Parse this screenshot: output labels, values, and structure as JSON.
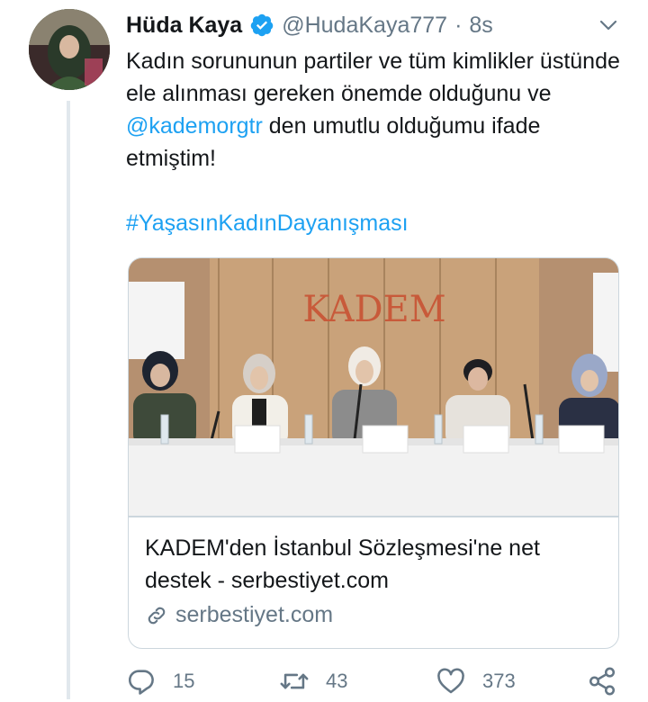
{
  "tweet": {
    "author_name": "Hüda Kaya",
    "handle": "@HudaKaya777",
    "separator": "·",
    "time": "8s",
    "text_before": "Kadın sorununun partiler ve tüm kimlikler üstünde ele alınması gereken önemde olduğunu ve ",
    "mention": "@kademorgtr",
    "text_after": " den umutlu olduğumu ifade etmiştim!",
    "hashtag": "#YaşasınKadınDayanışması"
  },
  "card": {
    "image_sign_text": "KADEM",
    "title": "KADEM'den İstanbul Sözleşmesi'ne net destek - serbestiyet.com",
    "domain": "serbestiyet.com"
  },
  "actions": {
    "replies": "15",
    "retweets": "43",
    "likes": "373"
  },
  "icons": {
    "verified": "verified-badge-icon",
    "more": "chevron-down-icon",
    "link": "link-icon",
    "reply": "reply-icon",
    "retweet": "retweet-icon",
    "like": "heart-icon",
    "share": "share-icon"
  },
  "colors": {
    "accent": "#1da1f2",
    "secondary_text": "#657786",
    "border": "#ccd6dd"
  }
}
